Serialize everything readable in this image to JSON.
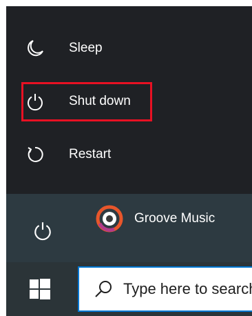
{
  "power_menu": {
    "items": [
      {
        "label": "Sleep",
        "icon": "moon-icon"
      },
      {
        "label": "Shut down",
        "icon": "power-icon",
        "highlighted": true
      },
      {
        "label": "Restart",
        "icon": "restart-icon"
      }
    ]
  },
  "start_menu": {
    "power_button_icon": "power-icon",
    "apps": [
      {
        "label": "Groove Music",
        "icon": "groove-music-icon"
      }
    ]
  },
  "taskbar": {
    "start_icon": "windows-icon",
    "search_placeholder": "Type here to search",
    "search_icon": "search-icon"
  },
  "colors": {
    "highlight_border": "#e81123",
    "search_focus_border": "#0078d4",
    "groove_accent": "#e8562b"
  }
}
